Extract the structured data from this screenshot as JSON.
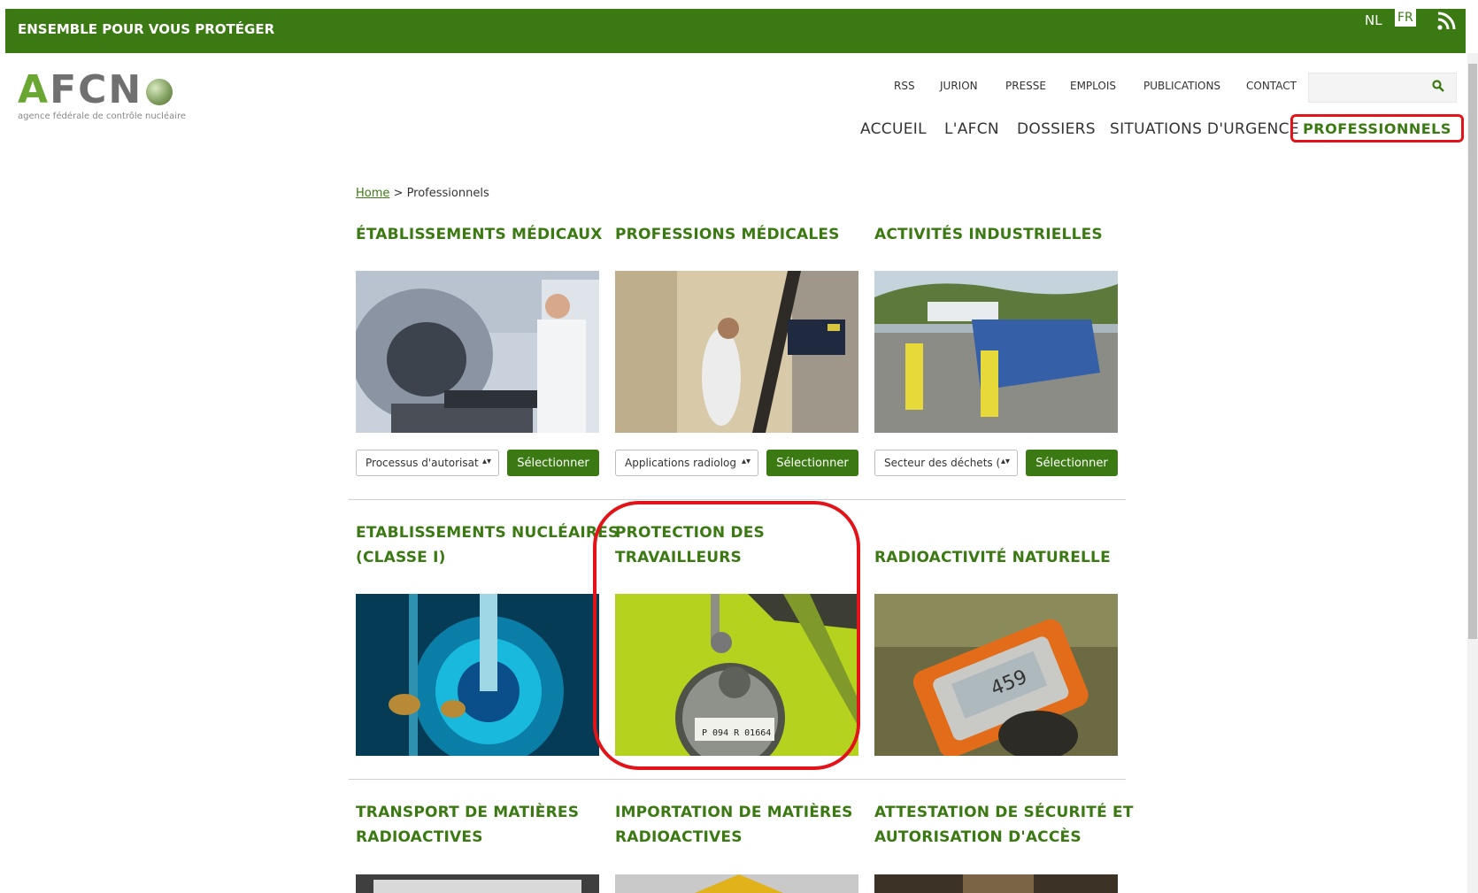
{
  "top_bar": {
    "tagline": "ENSEMBLE POUR VOUS PROTÉGER",
    "lang_nl": "NL",
    "lang_fr": "FR",
    "rss_icon": "rss-icon"
  },
  "logo": {
    "letter_a": "A",
    "letters_rest": "FCN",
    "subtitle": "agence fédérale de contrôle nucléaire"
  },
  "utility_nav": [
    "RSS",
    "JURION",
    "PRESSE",
    "EMPLOIS",
    "PUBLICATIONS",
    "CONTACT"
  ],
  "search": {
    "placeholder": "",
    "icon": "search-icon"
  },
  "main_nav": [
    "ACCUEIL",
    "L'AFCN",
    "DOSSIERS",
    "SITUATIONS D'URGENCE",
    "PROFESSIONNELS"
  ],
  "breadcrumb": {
    "home": "Home",
    "separator": " > ",
    "current": "Professionnels"
  },
  "categories": [
    {
      "title": "ÉTABLISSEMENTS MÉDICAUX",
      "select_value": "Processus d'autorisat",
      "button": "Sélectionner"
    },
    {
      "title": "PROFESSIONS MÉDICALES",
      "select_value": "Applications radiolog",
      "button": "Sélectionner"
    },
    {
      "title": "ACTIVITÉS INDUSTRIELLES",
      "select_value": "Secteur des déchets (",
      "button": "Sélectionner"
    },
    {
      "title_line1": "ETABLISSEMENTS NUCLÉAIRES",
      "title_line2": "(CLASSE I)"
    },
    {
      "title_line1": "PROTECTION DES",
      "title_line2": "TRAVAILLEURS",
      "badge_code": "P 094 R 01664"
    },
    {
      "title": "RADIOACTIVITÉ NATURELLE",
      "dosimeter_reading": "459"
    },
    {
      "title_line1": "TRANSPORT DE MATIÈRES",
      "title_line2": "RADIOACTIVES"
    },
    {
      "title_line1": "IMPORTATION DE MATIÈRES",
      "title_line2": "RADIOACTIVES"
    },
    {
      "title_line1": "ATTESTATION DE SÉCURITÉ ET",
      "title_line2": "AUTORISATION D'ACCÈS"
    }
  ],
  "colors": {
    "brand_green": "#3b7a13",
    "logo_green": "#6aa632",
    "highlight_red": "#e3131a"
  }
}
